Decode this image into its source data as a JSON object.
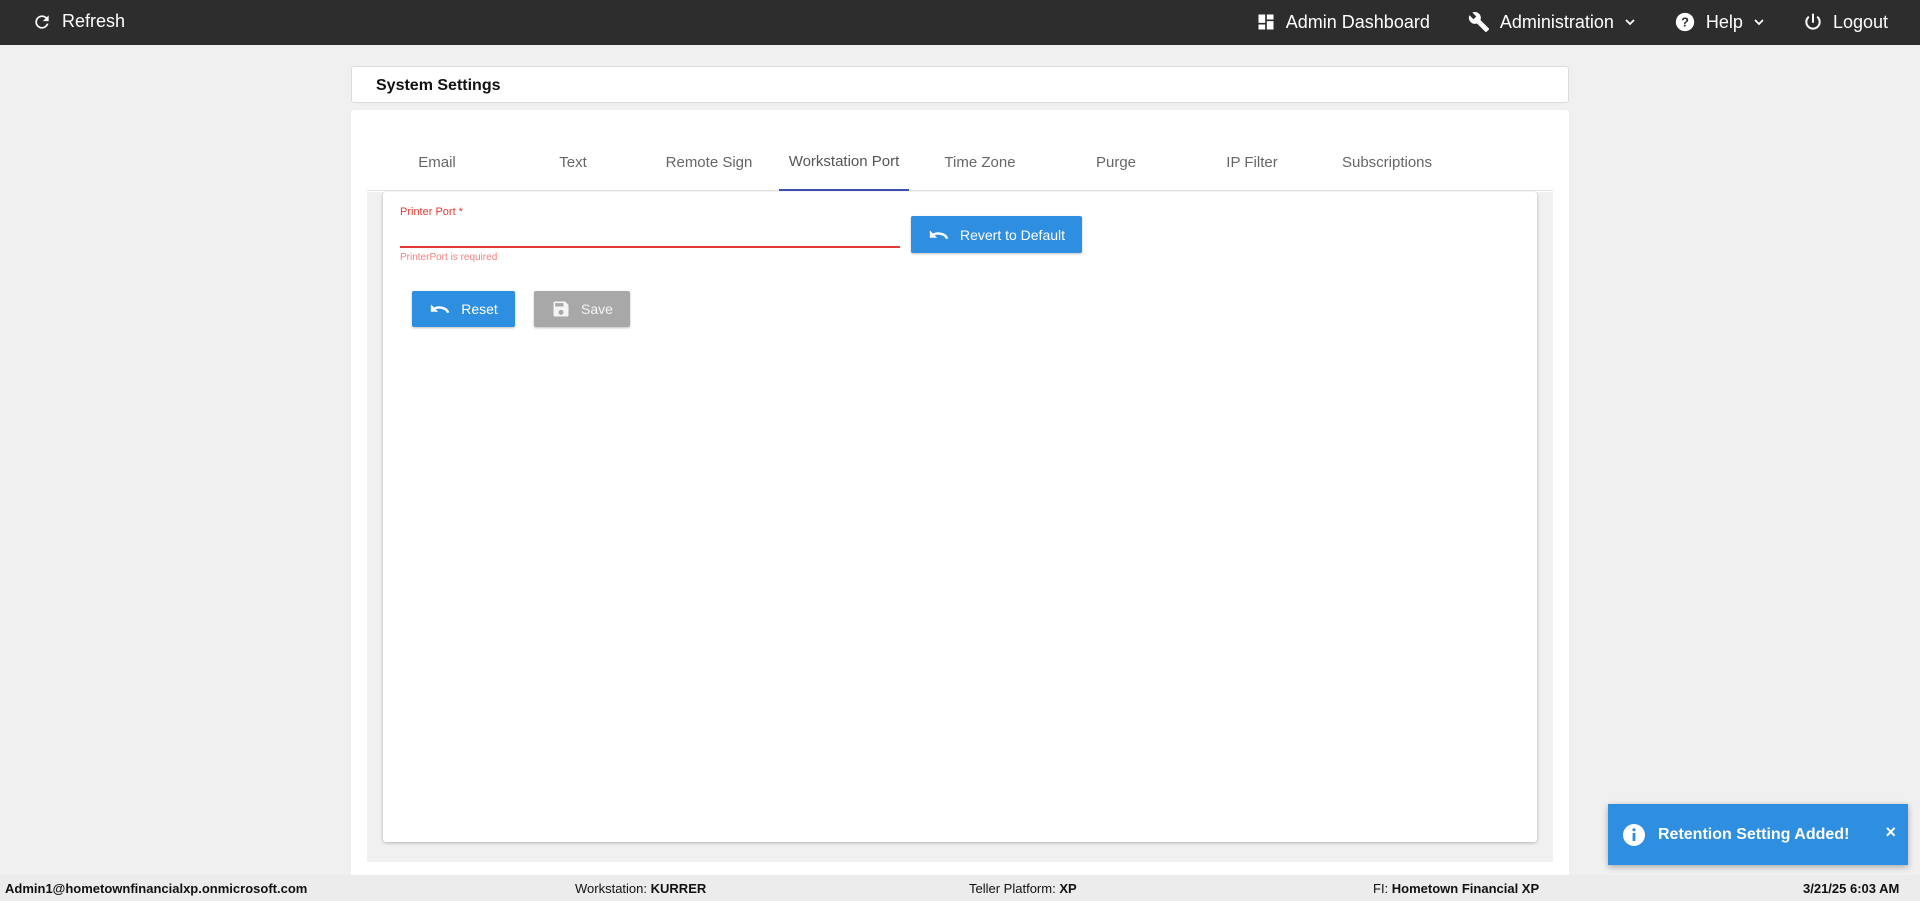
{
  "topbar": {
    "refresh_label": "Refresh",
    "admin_dashboard_label": "Admin Dashboard",
    "administration_label": "Administration",
    "help_label": "Help",
    "logout_label": "Logout"
  },
  "header": {
    "title": "System Settings"
  },
  "tabs": [
    {
      "label": "Email"
    },
    {
      "label": "Text"
    },
    {
      "label": "Remote Sign"
    },
    {
      "label": "Workstation Port",
      "active": true
    },
    {
      "label": "Time Zone"
    },
    {
      "label": "Purge"
    },
    {
      "label": "IP Filter"
    },
    {
      "label": "Subscriptions"
    }
  ],
  "form": {
    "printer_port_label": "Printer Port *",
    "printer_port_value": "",
    "printer_port_error": "PrinterPort is required",
    "revert_label": "Revert to Default",
    "reset_label": "Reset",
    "save_label": "Save"
  },
  "footer": {
    "user": "Admin1@hometownfinancialxp.onmicrosoft.com",
    "workstation_label": "Workstation:",
    "workstation_value": "KURRER",
    "teller_label": "Teller Platform:",
    "teller_value": "XP",
    "fi_label": "FI:",
    "fi_value": "Hometown Financial XP",
    "datetime": "3/21/25 6:03 AM"
  },
  "toast": {
    "message": "Retention Setting Added!",
    "close": "×"
  },
  "colors": {
    "topbar": "#2d2d2d",
    "accent_blue": "#2e8ee0",
    "tab_indicator": "#3f51b5",
    "error_red": "#e53935"
  }
}
